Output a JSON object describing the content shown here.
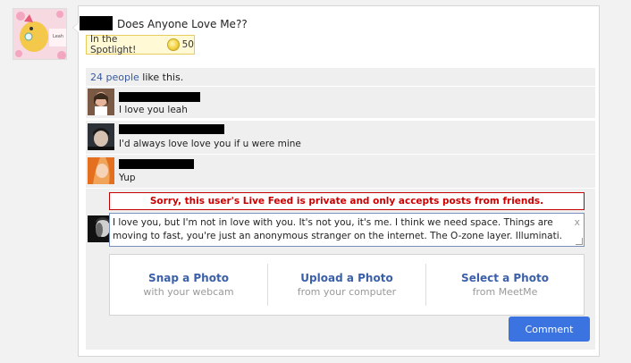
{
  "post": {
    "title": "Does Anyone Love Me??",
    "spotlight_label": "In the Spotlight!",
    "spotlight_points": "50",
    "avatar_text": "Leah"
  },
  "likes": {
    "count_link": "24 people",
    "suffix": " like this."
  },
  "comments": [
    {
      "text": "I love you leah"
    },
    {
      "text": "I'd always love love you if u were mine"
    },
    {
      "text": "Yup"
    }
  ],
  "notice": "Sorry, this user's Live Feed is private and only accepts posts from friends.",
  "composer": {
    "value": "I love you, but I'm not in love with you. It's not you, it's me. I think we need space. Things are moving to fast, you're just an anonymous stranger on the internet. The O-zone layer. Illuminati.",
    "clear_glyph": "x"
  },
  "photo_options": [
    {
      "title": "Snap a Photo",
      "subtitle": "with your webcam"
    },
    {
      "title": "Upload a Photo",
      "subtitle": "from your computer"
    },
    {
      "title": "Select a Photo",
      "subtitle": "from MeetMe"
    }
  ],
  "comment_button": "Comment",
  "colors": {
    "link": "#3a5a9a",
    "notice_red": "#cc0000",
    "button_blue": "#3b73e0"
  }
}
